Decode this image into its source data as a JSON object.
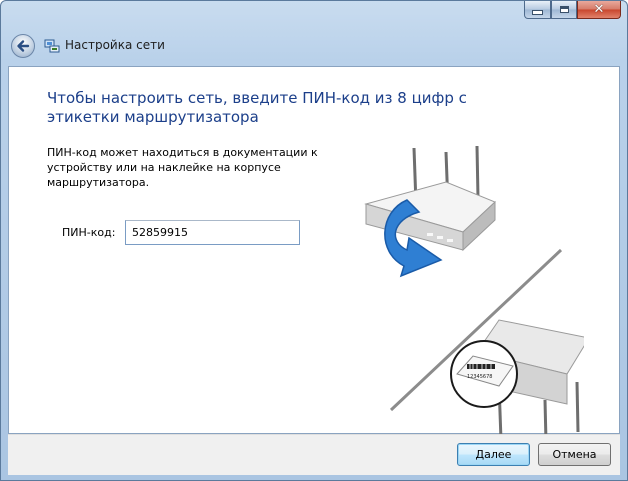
{
  "window": {
    "title": "Настройка сети",
    "icon": "network-setup-icon"
  },
  "caption_buttons": {
    "minimize": "minimize-icon",
    "maximize": "maximize-icon",
    "close": "close-icon"
  },
  "content": {
    "heading": "Чтобы настроить сеть, введите ПИН-код из 8 цифр с этикетки маршрутизатора",
    "description": "ПИН-код может находиться в документации к устройству или на наклейке на корпусе маршрутизатора.",
    "pin_label": "ПИН-код:",
    "pin_value": "52859915",
    "router_label_text": "12345678"
  },
  "footer": {
    "next_label": "Далее",
    "cancel_label": "Отмена"
  },
  "colors": {
    "heading": "#1c3f8a",
    "arrow": "#2f7fd3",
    "frame": "#b9d1ea"
  }
}
